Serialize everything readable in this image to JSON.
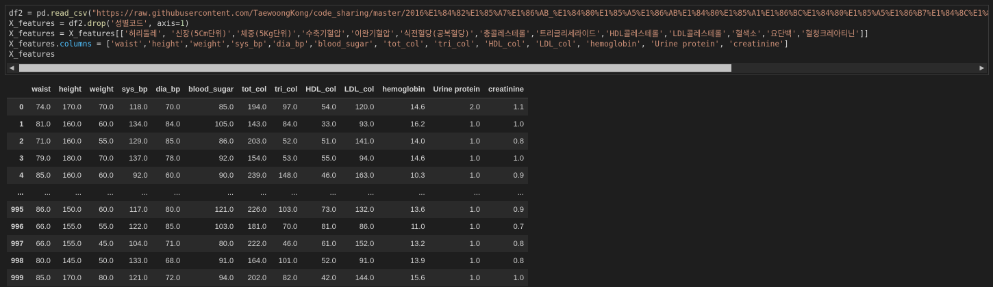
{
  "cell": {
    "lines": [
      [
        [
          "t",
          "df2 = pd."
        ],
        [
          "f",
          "read_csv"
        ],
        [
          "t",
          "("
        ],
        [
          "s",
          "\"https://raw.githubusercontent.com/TaewoongKong/code_sharing/master/2016%E1%84%82%E1%85%A7%E1%86%AB_%E1%84%80%E1%85%A5%E1%86%AB%E1%84%80%E1%85%A1%E1%86%BC%E1%84%80%E1%85%A5%E1%86%B7%E1%84%8C%E1%85"
        ]
      ],
      [
        [
          "t",
          "X_features = df2."
        ],
        [
          "f",
          "drop"
        ],
        [
          "t",
          "("
        ],
        [
          "s",
          "'성별코드'"
        ],
        [
          "t",
          ", axis="
        ],
        [
          "n",
          "1"
        ],
        [
          "t",
          ")"
        ]
      ],
      [
        [
          "t",
          "X_features = X_features[["
        ],
        [
          "s",
          "'허리둘레'"
        ],
        [
          "t",
          ", "
        ],
        [
          "s",
          "'신장(5Cm단위)'"
        ],
        [
          "t",
          ","
        ],
        [
          "s",
          "'체중(5Kg단위)'"
        ],
        [
          "t",
          ","
        ],
        [
          "s",
          "'수축기혈압'"
        ],
        [
          "t",
          ","
        ],
        [
          "s",
          "'이완기혈압'"
        ],
        [
          "t",
          ","
        ],
        [
          "s",
          "'식전혈당(공복혈당)'"
        ],
        [
          "t",
          ","
        ],
        [
          "s",
          "'총콜레스테롤'"
        ],
        [
          "t",
          ","
        ],
        [
          "s",
          "'트리글리세라이드'"
        ],
        [
          "t",
          ","
        ],
        [
          "s",
          "'HDL콜레스테롤'"
        ],
        [
          "t",
          ","
        ],
        [
          "s",
          "'LDL콜레스테롤'"
        ],
        [
          "t",
          ","
        ],
        [
          "s",
          "'혈색소'"
        ],
        [
          "t",
          ","
        ],
        [
          "s",
          "'요단백'"
        ],
        [
          "t",
          ","
        ],
        [
          "s",
          "'혈청크레아티닌'"
        ],
        [
          "t",
          "]]"
        ]
      ],
      [
        [
          "t",
          "X_features."
        ],
        [
          "a",
          "columns"
        ],
        [
          "t",
          " = ["
        ],
        [
          "s",
          "'waist'"
        ],
        [
          "t",
          ","
        ],
        [
          "s",
          "'height'"
        ],
        [
          "t",
          ","
        ],
        [
          "s",
          "'weight'"
        ],
        [
          "t",
          ","
        ],
        [
          "s",
          "'sys_bp'"
        ],
        [
          "t",
          ","
        ],
        [
          "s",
          "'dia_bp'"
        ],
        [
          "t",
          ","
        ],
        [
          "s",
          "'blood_sugar'"
        ],
        [
          "t",
          ", "
        ],
        [
          "s",
          "'tot_col'"
        ],
        [
          "t",
          ", "
        ],
        [
          "s",
          "'tri_col'"
        ],
        [
          "t",
          ", "
        ],
        [
          "s",
          "'HDL_col'"
        ],
        [
          "t",
          ", "
        ],
        [
          "s",
          "'LDL_col'"
        ],
        [
          "t",
          ", "
        ],
        [
          "s",
          "'hemoglobin'"
        ],
        [
          "t",
          ", "
        ],
        [
          "s",
          "'Urine protein'"
        ],
        [
          "t",
          ", "
        ],
        [
          "s",
          "'creatinine'"
        ],
        [
          "t",
          "]"
        ]
      ],
      [
        [
          "t",
          "X_features"
        ]
      ]
    ]
  },
  "scroll": {
    "left_arrow": "◀",
    "right_arrow": "▶"
  },
  "table": {
    "columns": [
      "waist",
      "height",
      "weight",
      "sys_bp",
      "dia_bp",
      "blood_sugar",
      "tot_col",
      "tri_col",
      "HDL_col",
      "LDL_col",
      "hemoglobin",
      "Urine protein",
      "creatinine"
    ],
    "rows": [
      {
        "index": "0",
        "cells": [
          "74.0",
          "170.0",
          "70.0",
          "118.0",
          "70.0",
          "85.0",
          "194.0",
          "97.0",
          "54.0",
          "120.0",
          "14.6",
          "2.0",
          "1.1"
        ]
      },
      {
        "index": "1",
        "cells": [
          "81.0",
          "160.0",
          "60.0",
          "134.0",
          "84.0",
          "105.0",
          "143.0",
          "84.0",
          "33.0",
          "93.0",
          "16.2",
          "1.0",
          "1.0"
        ]
      },
      {
        "index": "2",
        "cells": [
          "71.0",
          "160.0",
          "55.0",
          "129.0",
          "85.0",
          "86.0",
          "203.0",
          "52.0",
          "51.0",
          "141.0",
          "14.0",
          "1.0",
          "0.8"
        ]
      },
      {
        "index": "3",
        "cells": [
          "79.0",
          "180.0",
          "70.0",
          "137.0",
          "78.0",
          "92.0",
          "154.0",
          "53.0",
          "55.0",
          "94.0",
          "14.6",
          "1.0",
          "1.0"
        ]
      },
      {
        "index": "4",
        "cells": [
          "85.0",
          "160.0",
          "60.0",
          "92.0",
          "60.0",
          "90.0",
          "239.0",
          "148.0",
          "46.0",
          "163.0",
          "10.3",
          "1.0",
          "0.9"
        ]
      },
      {
        "index": "...",
        "cells": [
          "...",
          "...",
          "...",
          "...",
          "...",
          "...",
          "...",
          "...",
          "...",
          "...",
          "...",
          "...",
          "..."
        ]
      },
      {
        "index": "995",
        "cells": [
          "86.0",
          "150.0",
          "60.0",
          "117.0",
          "80.0",
          "121.0",
          "226.0",
          "103.0",
          "73.0",
          "132.0",
          "13.6",
          "1.0",
          "0.9"
        ]
      },
      {
        "index": "996",
        "cells": [
          "66.0",
          "155.0",
          "55.0",
          "122.0",
          "85.0",
          "103.0",
          "181.0",
          "70.0",
          "81.0",
          "86.0",
          "11.0",
          "1.0",
          "0.7"
        ]
      },
      {
        "index": "997",
        "cells": [
          "66.0",
          "155.0",
          "45.0",
          "104.0",
          "71.0",
          "80.0",
          "222.0",
          "46.0",
          "61.0",
          "152.0",
          "13.2",
          "1.0",
          "0.8"
        ]
      },
      {
        "index": "998",
        "cells": [
          "80.0",
          "145.0",
          "50.0",
          "133.0",
          "68.0",
          "91.0",
          "164.0",
          "101.0",
          "52.0",
          "91.0",
          "13.9",
          "1.0",
          "0.8"
        ]
      },
      {
        "index": "999",
        "cells": [
          "85.0",
          "170.0",
          "80.0",
          "121.0",
          "72.0",
          "94.0",
          "202.0",
          "82.0",
          "42.0",
          "144.0",
          "15.6",
          "1.0",
          "1.0"
        ]
      }
    ]
  },
  "colors": {
    "background": "#1e1e1e",
    "string": "#ce9178",
    "function": "#dcdcaa",
    "number": "#b5cea8",
    "attribute": "#4fc1ff",
    "row_stripe": "#2a2a2a"
  }
}
